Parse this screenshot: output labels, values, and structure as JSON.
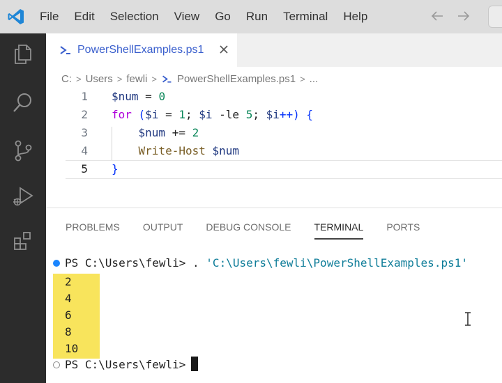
{
  "menu": [
    "File",
    "Edit",
    "Selection",
    "View",
    "Go",
    "Run",
    "Terminal",
    "Help"
  ],
  "editor": {
    "tab_label": "PowerShellExamples.ps1",
    "breadcrumb": {
      "drive": "C:",
      "folder1": "Users",
      "folder2": "fewli",
      "file": "PowerShellExamples.ps1",
      "ellipsis": "..."
    },
    "lines": [
      {
        "no": "1",
        "t1": "$num",
        "t2": " = ",
        "t3": "0"
      },
      {
        "no": "2",
        "t1": "for",
        "t2": " (",
        "t3": "$i",
        "t4": " = ",
        "t5": "1",
        "t6": "; ",
        "t7": "$i",
        "t8": " -le ",
        "t9": "5",
        "t10": "; ",
        "t11": "$i",
        "t12": "++) ",
        "t13": "{"
      },
      {
        "no": "3",
        "t1": "    ",
        "t2": "$num",
        "t3": " += ",
        "t4": "2"
      },
      {
        "no": "4",
        "t1": "    ",
        "t2": "Write-Host",
        "t3": " ",
        "t4": "$num"
      },
      {
        "no": "5",
        "t1": "}"
      }
    ]
  },
  "panel": {
    "tabs": [
      "PROBLEMS",
      "OUTPUT",
      "DEBUG CONSOLE",
      "TERMINAL",
      "PORTS"
    ],
    "active_tab": "TERMINAL"
  },
  "terminal": {
    "prompt": "PS C:\\Users\\fewli>",
    "command": ". ",
    "command_arg": "'C:\\Users\\fewli\\PowerShellExamples.ps1'",
    "output": [
      "2",
      "4",
      "6",
      "8",
      "10"
    ]
  },
  "colors": {
    "accent": "#1a85ff",
    "highlight": "#f8e45c",
    "activity_bar": "#2c2c2c"
  }
}
